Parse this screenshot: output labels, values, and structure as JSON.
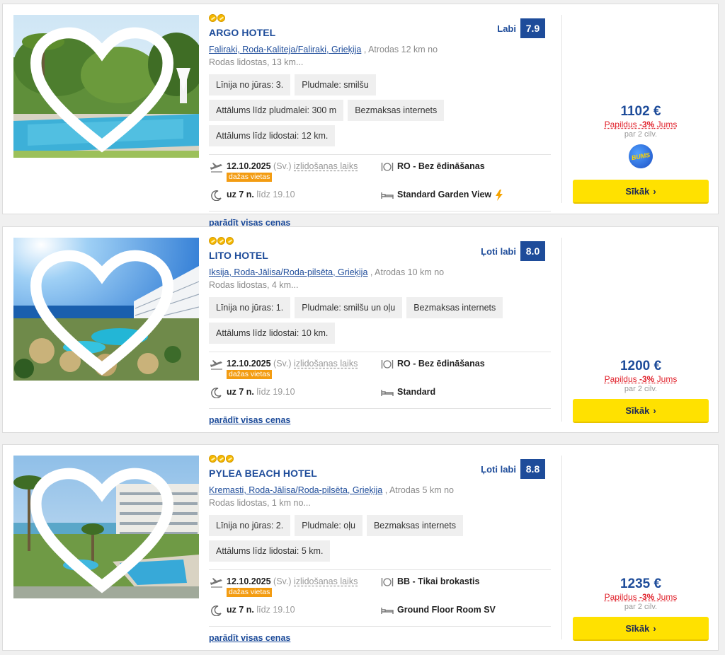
{
  "hotels": [
    {
      "name": "ARGO HOTEL",
      "location_link": "Faliraki, Roda-Kaliteja/Faliraki, Grieķija",
      "location_rest": " , Atrodas 12 km no Rodas lidostas, 13 km...",
      "rating_label": "Labi",
      "rating": "7.9",
      "features": [
        "Līnija no jūras: 3.",
        "Pludmale: smilšu",
        "Attālums līdz pludmalei: 300 m",
        "Bezmaksas internets",
        "Attālums līdz lidostai: 12 km."
      ],
      "date": "12.10.2025",
      "day": "(Sv.)",
      "departure_label": "izlidošanas laiks",
      "few_seats": "dažas vietas",
      "board": "RO - Bez ēdināšanas",
      "nights": "uz 7 n.",
      "until": "līdz 19.10",
      "room": "Standard Garden View",
      "room_flash": true,
      "show_prices": "parādīt visas cenas",
      "price": "1102 €",
      "extra_prefix": "Papildus ",
      "extra_discount": "-3%",
      "extra_suffix": " Jums",
      "per": "par 2 cilv.",
      "badge": "BUMS",
      "button": "Sīkāk"
    },
    {
      "name": "LITO HOTEL",
      "location_link": "Iksija, Roda-Jālisa/Roda-pilsēta, Grieķija",
      "location_rest": " , Atrodas 10 km no Rodas lidostas, 4 km...",
      "rating_label": "Ļoti labi",
      "rating": "8.0",
      "features": [
        "Līnija no jūras: 1.",
        "Pludmale: smilšu un oļu",
        "Bezmaksas internets",
        "Attālums līdz lidostai: 10 km."
      ],
      "date": "12.10.2025",
      "day": "(Sv.)",
      "departure_label": "izlidošanas laiks",
      "few_seats": "dažas vietas",
      "board": "RO - Bez ēdināšanas",
      "nights": "uz 7 n.",
      "until": "līdz 19.10",
      "room": "Standard",
      "room_flash": false,
      "show_prices": "parādīt visas cenas",
      "price": "1200 €",
      "extra_prefix": "Papildus ",
      "extra_discount": "-3%",
      "extra_suffix": " Jums",
      "per": "par 2 cilv.",
      "badge": "",
      "button": "Sīkāk"
    },
    {
      "name": "PYLEA BEACH HOTEL",
      "location_link": "Kremasti, Roda-Jālisa/Roda-pilsēta, Grieķija",
      "location_rest": " , Atrodas 5 km no Rodas lidostas, 1 km no...",
      "rating_label": "Ļoti labi",
      "rating": "8.8",
      "features": [
        "Līnija no jūras: 2.",
        "Pludmale: oļu",
        "Bezmaksas internets",
        "Attālums līdz lidostai: 5 km."
      ],
      "date": "12.10.2025",
      "day": "(Sv.)",
      "departure_label": "izlidošanas laiks",
      "few_seats": "dažas vietas",
      "board": "BB - Tikai brokastis",
      "nights": "uz 7 n.",
      "until": "līdz 19.10",
      "room": "Ground Floor Room SV",
      "room_flash": false,
      "show_prices": "parādīt visas cenas",
      "price": "1235 €",
      "extra_prefix": "Papildus ",
      "extra_discount": "-3%",
      "extra_suffix": " Jums",
      "per": "par 2 cilv.",
      "badge": "",
      "button": "Sīkāk"
    }
  ],
  "stars": [
    2,
    3,
    3
  ],
  "colors": {
    "brand_blue": "#1e4c9a",
    "button_yellow": "#ffe100",
    "discount_red": "#e0202a",
    "badge_orange": "#f39c12"
  },
  "icons": [
    "heart-icon",
    "plane-icon",
    "moon-icon",
    "cutlery-icon",
    "bed-icon",
    "flash-icon",
    "chevron-right-icon"
  ]
}
